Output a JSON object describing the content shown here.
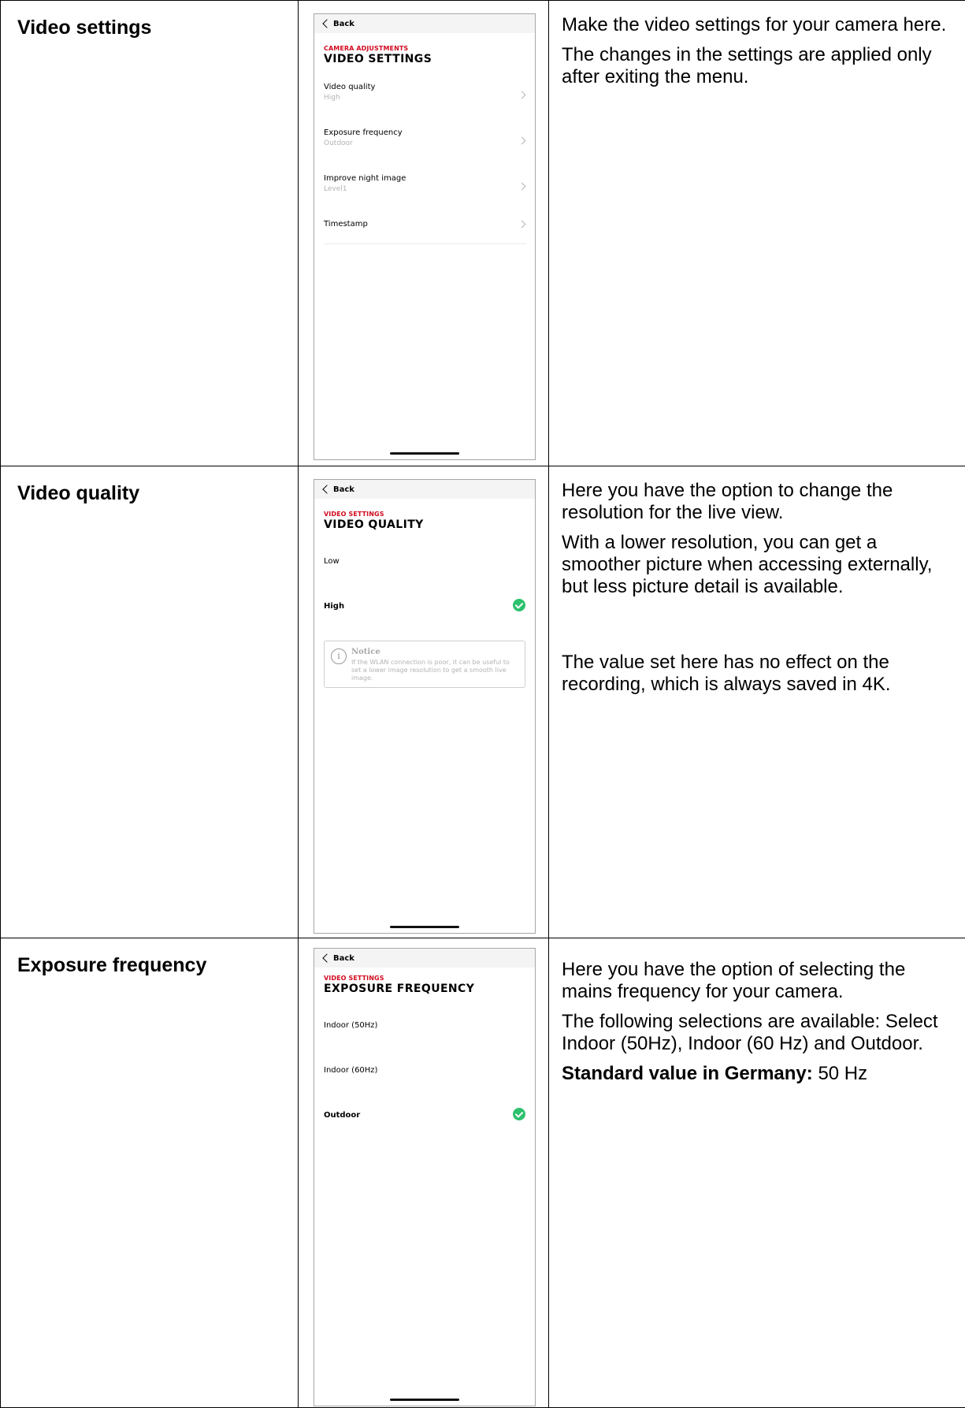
{
  "rows": [
    {
      "title": "Video settings",
      "phone": {
        "back": "Back",
        "breadcrumb": "CAMERA ADJUSTMENTS",
        "title": "VIDEO SETTINGS",
        "menu": [
          {
            "label": "Video quality",
            "value": "High"
          },
          {
            "label": "Exposure frequency",
            "value": "Outdoor"
          },
          {
            "label": "Improve night image",
            "value": "Level1"
          },
          {
            "label": "Timestamp",
            "value": ""
          }
        ]
      },
      "description": [
        "Make the video settings for your camera here.",
        "The changes in the settings are applied only after exiting the menu."
      ]
    },
    {
      "title": "Video quality",
      "phone": {
        "back": "Back",
        "breadcrumb": "VIDEO SETTINGS",
        "title": "VIDEO QUALITY",
        "options": [
          {
            "label": "Low",
            "selected": false
          },
          {
            "label": "High",
            "selected": true
          }
        ],
        "notice": {
          "title": "Notice",
          "text": "If the WLAN connection is poor, it can be useful to set a lower image resolution to get a smooth live image."
        }
      },
      "description": [
        "Here you have the option to change the resolution for the live view.",
        "With a lower resolution, you can get a smoother picture when accessing externally, but less picture detail is available.",
        "The value set here has no effect on the recording, which is always saved in 4K."
      ]
    },
    {
      "title": "Exposure frequency",
      "phone": {
        "back": "Back",
        "breadcrumb": "VIDEO SETTINGS",
        "title": "EXPOSURE FREQUENCY",
        "options": [
          {
            "label": "Indoor (50Hz)",
            "selected": false
          },
          {
            "label": "Indoor (60Hz)",
            "selected": false
          },
          {
            "label": "Outdoor",
            "selected": true
          }
        ]
      },
      "description": [
        "Here you have the option of selecting the mains frequency for your camera.",
        "The following selections are available: Select Indoor (50Hz), Indoor (60 Hz) and Outdoor."
      ],
      "standard_label": "Standard value in Germany:",
      "standard_value": "50 Hz"
    }
  ],
  "colors": {
    "accent_red": "#d10a1e",
    "check_green": "#2cc16d"
  }
}
